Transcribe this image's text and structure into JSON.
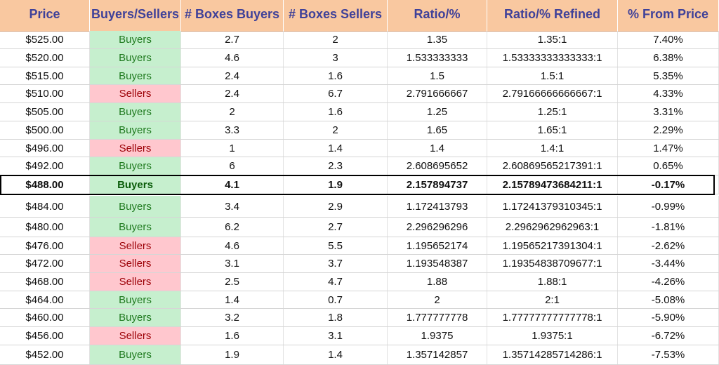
{
  "colors": {
    "header_bg": "#f9c8a0",
    "header_text": "#3f4199",
    "buyers_bg": "#c6efce",
    "buyers_text": "#1f7a1f",
    "sellers_bg": "#ffc7ce",
    "sellers_text": "#9c0006"
  },
  "header": {
    "price": "Price",
    "side": "Buyers/Sellers",
    "boxes_buyers": "# Boxes Buyers",
    "boxes_sellers": "# Boxes Sellers",
    "ratio": "Ratio/%",
    "ratio_refined": "Ratio/% Refined",
    "from_price": "% From Price"
  },
  "rows": [
    {
      "price": "$525.00",
      "side": "Buyers",
      "boxes_buyers": "2.7",
      "boxes_sellers": "2",
      "ratio": "1.35",
      "ratio_refined": "1.35:1",
      "from_price": "7.40%"
    },
    {
      "price": "$520.00",
      "side": "Buyers",
      "boxes_buyers": "4.6",
      "boxes_sellers": "3",
      "ratio": "1.533333333",
      "ratio_refined": "1.53333333333333:1",
      "from_price": "6.38%"
    },
    {
      "price": "$515.00",
      "side": "Buyers",
      "boxes_buyers": "2.4",
      "boxes_sellers": "1.6",
      "ratio": "1.5",
      "ratio_refined": "1.5:1",
      "from_price": "5.35%"
    },
    {
      "price": "$510.00",
      "side": "Sellers",
      "boxes_buyers": "2.4",
      "boxes_sellers": "6.7",
      "ratio": "2.791666667",
      "ratio_refined": "2.79166666666667:1",
      "from_price": "4.33%"
    },
    {
      "price": "$505.00",
      "side": "Buyers",
      "boxes_buyers": "2",
      "boxes_sellers": "1.6",
      "ratio": "1.25",
      "ratio_refined": "1.25:1",
      "from_price": "3.31%"
    },
    {
      "price": "$500.00",
      "side": "Buyers",
      "boxes_buyers": "3.3",
      "boxes_sellers": "2",
      "ratio": "1.65",
      "ratio_refined": "1.65:1",
      "from_price": "2.29%"
    },
    {
      "price": "$496.00",
      "side": "Sellers",
      "boxes_buyers": "1",
      "boxes_sellers": "1.4",
      "ratio": "1.4",
      "ratio_refined": "1.4:1",
      "from_price": "1.47%"
    },
    {
      "price": "$492.00",
      "side": "Buyers",
      "boxes_buyers": "6",
      "boxes_sellers": "2.3",
      "ratio": "2.608695652",
      "ratio_refined": "2.60869565217391:1",
      "from_price": "0.65%"
    },
    {
      "price": "$488.00",
      "side": "Buyers",
      "boxes_buyers": "4.1",
      "boxes_sellers": "1.9",
      "ratio": "2.157894737",
      "ratio_refined": "2.15789473684211:1",
      "from_price": "-0.17%",
      "current": true
    },
    {
      "price": "$484.00",
      "side": "Buyers",
      "boxes_buyers": "3.4",
      "boxes_sellers": "2.9",
      "ratio": "1.172413793",
      "ratio_refined": "1.17241379310345:1",
      "from_price": "-0.99%"
    },
    {
      "price": "$480.00",
      "side": "Buyers",
      "boxes_buyers": "6.2",
      "boxes_sellers": "2.7",
      "ratio": "2.296296296",
      "ratio_refined": "2.2962962962963:1",
      "from_price": "-1.81%"
    },
    {
      "price": "$476.00",
      "side": "Sellers",
      "boxes_buyers": "4.6",
      "boxes_sellers": "5.5",
      "ratio": "1.195652174",
      "ratio_refined": "1.19565217391304:1",
      "from_price": "-2.62%"
    },
    {
      "price": "$472.00",
      "side": "Sellers",
      "boxes_buyers": "3.1",
      "boxes_sellers": "3.7",
      "ratio": "1.193548387",
      "ratio_refined": "1.19354838709677:1",
      "from_price": "-3.44%"
    },
    {
      "price": "$468.00",
      "side": "Sellers",
      "boxes_buyers": "2.5",
      "boxes_sellers": "4.7",
      "ratio": "1.88",
      "ratio_refined": "1.88:1",
      "from_price": "-4.26%"
    },
    {
      "price": "$464.00",
      "side": "Buyers",
      "boxes_buyers": "1.4",
      "boxes_sellers": "0.7",
      "ratio": "2",
      "ratio_refined": "2:1",
      "from_price": "-5.08%"
    },
    {
      "price": "$460.00",
      "side": "Buyers",
      "boxes_buyers": "3.2",
      "boxes_sellers": "1.8",
      "ratio": "1.777777778",
      "ratio_refined": "1.77777777777778:1",
      "from_price": "-5.90%"
    },
    {
      "price": "$456.00",
      "side": "Sellers",
      "boxes_buyers": "1.6",
      "boxes_sellers": "3.1",
      "ratio": "1.9375",
      "ratio_refined": "1.9375:1",
      "from_price": "-6.72%"
    },
    {
      "price": "$452.00",
      "side": "Buyers",
      "boxes_buyers": "1.9",
      "boxes_sellers": "1.4",
      "ratio": "1.357142857",
      "ratio_refined": "1.35714285714286:1",
      "from_price": "-7.53%"
    }
  ]
}
